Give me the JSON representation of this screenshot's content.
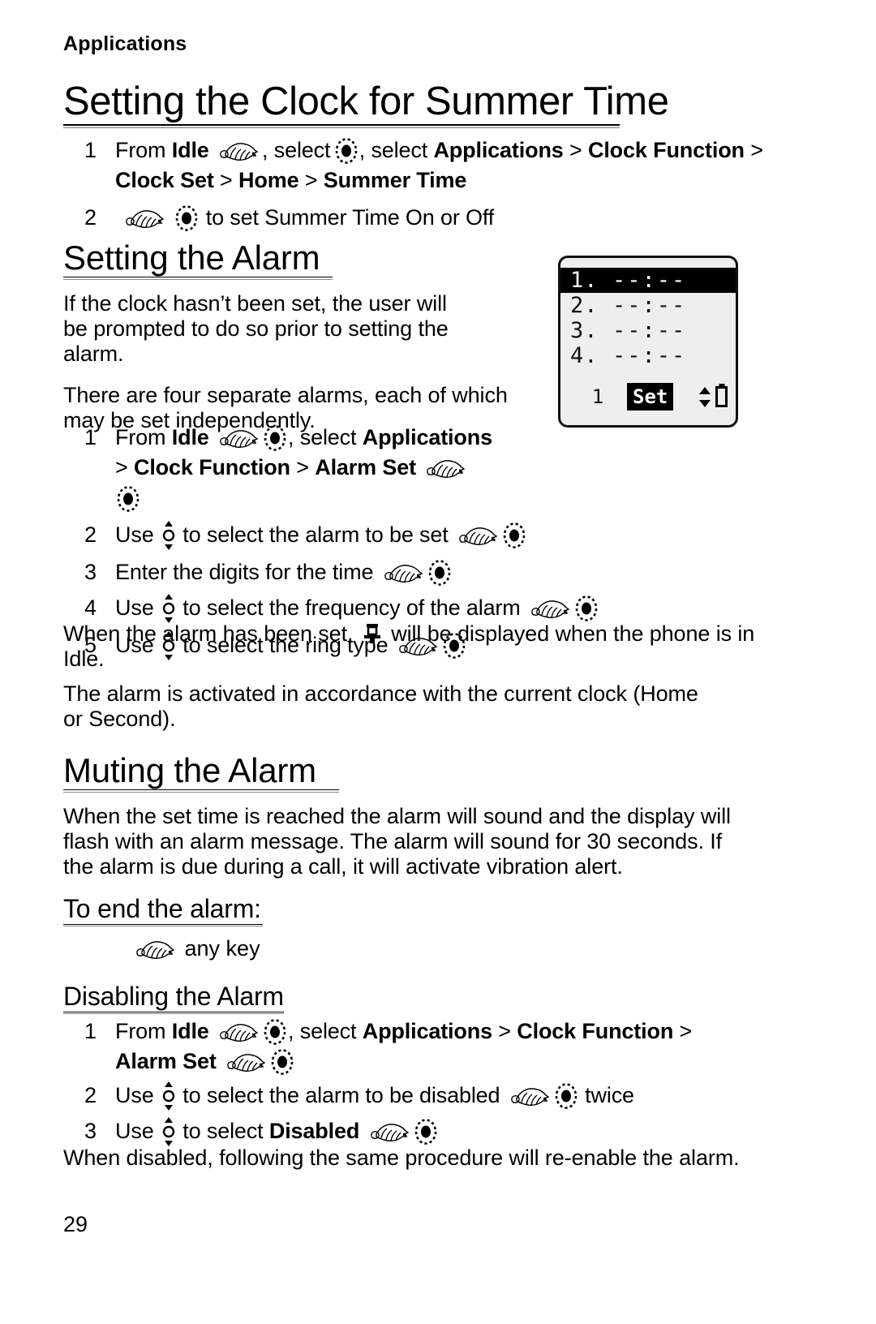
{
  "page": {
    "running_head": "Applications",
    "folio": "29"
  },
  "sections": {
    "summer_time": {
      "heading": "Setting the Clock for Summer Time",
      "steps": [
        {
          "num": "1",
          "line1_pre": "From ",
          "line1_idle": "Idle",
          "line1_mid": ", select ",
          "line1_applications": "Applications",
          "line1_gt1": " > ",
          "line1_clock_function": "Clock Function",
          "line1_gt2": " >",
          "line2_clock_set": "Clock Set",
          "line2_gt1": " > ",
          "line2_home": "Home",
          "line2_gt2": " > ",
          "line2_summer_time": "Summer Time"
        },
        {
          "num": "2",
          "text": "to set Summer Time On or Off"
        }
      ]
    },
    "setting_alarm": {
      "heading": "Setting the Alarm",
      "para1": "If the clock hasn’t been set, the user will be prompted to do so prior to setting the alarm.",
      "para2": "There are four separate alarms, each of which may be set independently.",
      "steps": [
        {
          "num": "1",
          "line1_pre": "From ",
          "line1_idle": "Idle",
          "line1_mid": ", select ",
          "line1_applications": "Applications",
          "line2_gt1": "> ",
          "line2_clock_function": "Clock Function",
          "line2_gt2": " > ",
          "line2_alarm_set": "Alarm Set"
        },
        {
          "num": "2",
          "pre": "Use ",
          "post": "to select the alarm to be set"
        },
        {
          "num": "3",
          "text": "Enter the digits for the time"
        },
        {
          "num": "4",
          "pre": "Use ",
          "post": "to select the frequency of the alarm"
        },
        {
          "num": "5",
          "pre": "Use ",
          "post": "to select the ring type"
        }
      ],
      "para3_pre": "When the alarm has been set, ",
      "para3_post": " will be displayed when the phone is in Idle.",
      "para4": "The alarm is activated in accordance with the current clock (Home or Second)."
    },
    "muting_alarm": {
      "heading": "Muting the Alarm",
      "para1": "When the set time is reached the alarm will sound and the display will flash with an alarm message. The alarm will sound for 30 seconds. If the alarm is due during a call, it will activate vibration alert.",
      "to_end": {
        "heading": "To end the alarm:",
        "text": "any key"
      },
      "disabling": {
        "heading": "Disabling the Alarm",
        "steps": [
          {
            "num": "1",
            "line1_pre": "From ",
            "line1_idle": "Idle",
            "line1_mid": ", select ",
            "line1_applications": "Applications",
            "line1_gt1": " > ",
            "line1_clock_function": "Clock Function",
            "line1_gt2": " >",
            "line2_alarm_set": "Alarm Set"
          },
          {
            "num": "2",
            "pre": "Use ",
            "post": "to select the alarm to be disabled",
            "trail": "twice"
          },
          {
            "num": "3",
            "pre": "Use ",
            "post_bold": "Disabled",
            "post_pre": "to select "
          }
        ],
        "closing": "When disabled, following the same procedure will re-enable the alarm."
      }
    }
  },
  "lcd": {
    "rows": [
      {
        "index": "1.",
        "time": "--:--",
        "selected": true
      },
      {
        "index": "2.",
        "time": "--:--",
        "selected": false
      },
      {
        "index": "3.",
        "time": "--:--",
        "selected": false
      },
      {
        "index": "4.",
        "time": "--:--",
        "selected": false
      }
    ],
    "soft_left": "1",
    "soft_mid": "Set",
    "icons": {
      "updown": "up-down-scroll-icon",
      "battery": "battery-icon"
    }
  },
  "icon_names": {
    "hand": "pointing-hand-icon",
    "ok_key": "ok-select-key-icon",
    "nav_key": "up-down-navigation-key-icon",
    "bell": "alarm-bell-icon"
  },
  "colors": {
    "ink": "#000000",
    "paper": "#ffffff",
    "lcd_bg": "#eeeeee",
    "lcd_rule": "#777777"
  }
}
